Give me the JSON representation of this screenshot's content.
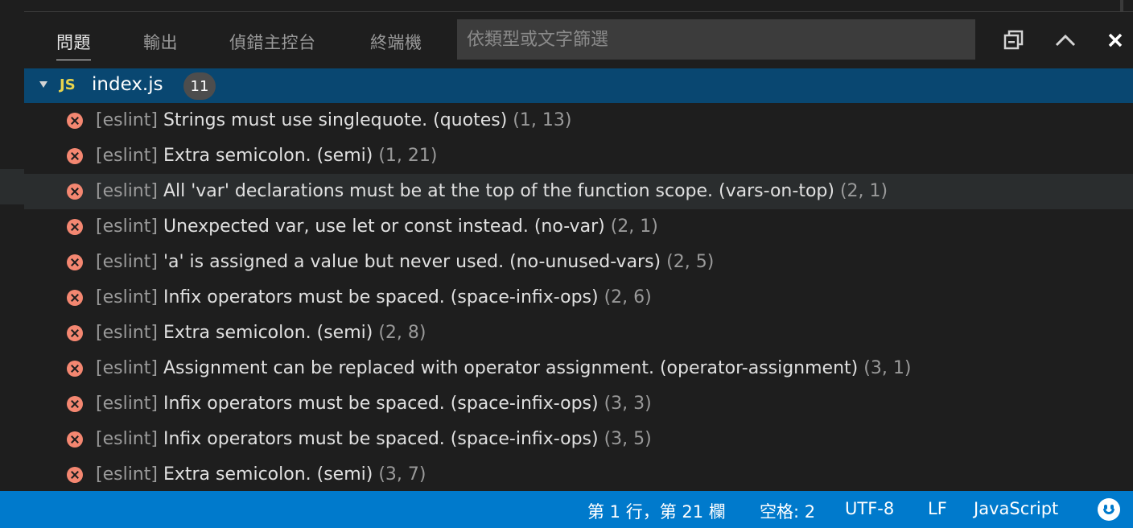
{
  "panel": {
    "tabs": [
      {
        "label": "問題",
        "active": true
      },
      {
        "label": "輸出",
        "active": false
      },
      {
        "label": "偵錯主控台",
        "active": false
      },
      {
        "label": "終端機",
        "active": false
      }
    ],
    "filter": {
      "placeholder": "依類型或文字篩選",
      "value": ""
    },
    "actions": {
      "collapse_all_icon": "collapse-all-icon",
      "maximize_icon": "chevron-up-icon",
      "close_icon": "close-icon"
    }
  },
  "file": {
    "icon": "JS",
    "name": "index.js",
    "count": "11"
  },
  "problems": [
    {
      "source": "[eslint]",
      "message": "Strings must use singlequote. (quotes)",
      "location": "(1, 13)"
    },
    {
      "source": "[eslint]",
      "message": "Extra semicolon. (semi)",
      "location": "(1, 21)"
    },
    {
      "source": "[eslint]",
      "message": "All 'var' declarations must be at the top of the function scope. (vars-on-top)",
      "location": "(2, 1)"
    },
    {
      "source": "[eslint]",
      "message": "Unexpected var, use let or const instead. (no-var)",
      "location": "(2, 1)"
    },
    {
      "source": "[eslint]",
      "message": "'a' is assigned a value but never used. (no-unused-vars)",
      "location": "(2, 5)"
    },
    {
      "source": "[eslint]",
      "message": "Infix operators must be spaced. (space-infix-ops)",
      "location": "(2, 6)"
    },
    {
      "source": "[eslint]",
      "message": "Extra semicolon. (semi)",
      "location": "(2, 8)"
    },
    {
      "source": "[eslint]",
      "message": "Assignment can be replaced with operator assignment. (operator-assignment)",
      "location": "(3, 1)"
    },
    {
      "source": "[eslint]",
      "message": "Infix operators must be spaced. (space-infix-ops)",
      "location": "(3, 3)"
    },
    {
      "source": "[eslint]",
      "message": "Infix operators must be spaced. (space-infix-ops)",
      "location": "(3, 5)"
    },
    {
      "source": "[eslint]",
      "message": "Extra semicolon. (semi)",
      "location": "(3, 7)"
    }
  ],
  "statusbar": {
    "position": "第 1 行，第 21 欄",
    "indent": "空格: 2",
    "encoding": "UTF-8",
    "eol": "LF",
    "language": "JavaScript",
    "feedback_icon": "smiley-icon"
  },
  "colors": {
    "statusbar_bg": "#007acc",
    "selected_row_bg": "#094771",
    "error_icon": "#f48771",
    "js_badge": "#e8d44d"
  }
}
